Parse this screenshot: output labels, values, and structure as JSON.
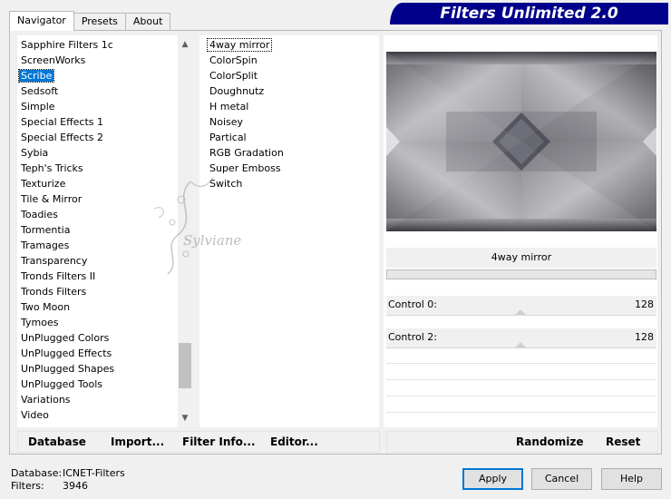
{
  "tabs": [
    {
      "label": "Navigator",
      "active": true
    },
    {
      "label": "Presets",
      "active": false
    },
    {
      "label": "About",
      "active": false
    }
  ],
  "banner": {
    "title": "Filters Unlimited 2.0"
  },
  "categories": {
    "selected": "Scribe",
    "items": [
      "Sapphire Filters 1c",
      "ScreenWorks",
      "Scribe",
      "Sedsoft",
      "Simple",
      "Special Effects 1",
      "Special Effects 2",
      "Sybia",
      "Teph's Tricks",
      "Texturize",
      "Tile & Mirror",
      "Toadies",
      "Tormentia",
      "Tramages",
      "Transparency",
      "Tronds Filters II",
      "Tronds Filters",
      "Two Moon",
      "Tymoes",
      "UnPlugged Colors",
      "UnPlugged Effects",
      "UnPlugged Shapes",
      "UnPlugged Tools",
      "Variations",
      "Video"
    ]
  },
  "filters": {
    "selected": "4way mirror",
    "items": [
      "4way mirror",
      "ColorSpin",
      "ColorSplit",
      "Doughnutz",
      "H metal",
      "Noisey",
      "Partical",
      "RGB Gradation",
      "Super Emboss",
      "Switch"
    ]
  },
  "preview": {
    "filter_name": "4way mirror"
  },
  "controls": [
    {
      "label": "Control 0:",
      "value": "128",
      "level": 128
    },
    {
      "label": "Control 2:",
      "value": "128",
      "level": 128
    }
  ],
  "left_buttons": {
    "database": "Database",
    "import": "Import...",
    "filter_info": "Filter Info...",
    "editor": "Editor..."
  },
  "right_buttons": {
    "randomize": "Randomize",
    "reset": "Reset"
  },
  "status": {
    "database_label": "Database:",
    "database_value": "ICNET-Filters",
    "filters_label": "Filters:",
    "filters_value": "3946"
  },
  "dialog_buttons": {
    "apply": "Apply",
    "cancel": "Cancel",
    "help": "Help"
  },
  "watermark": {
    "text": "Sylviane"
  },
  "colors": {
    "banner": "#00008b",
    "selection": "#0078d7"
  }
}
